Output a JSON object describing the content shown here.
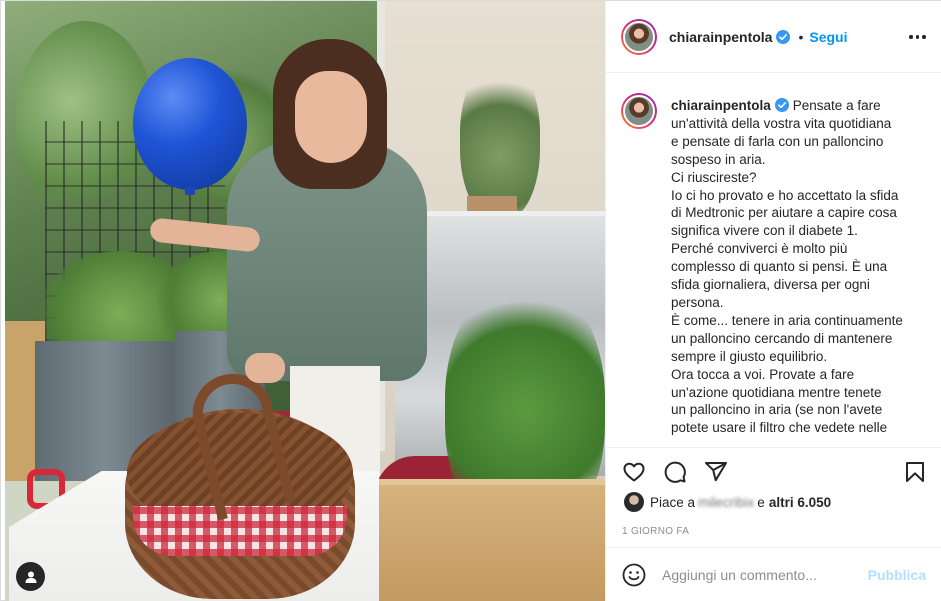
{
  "post": {
    "username": "chiarainpentola",
    "verified": true,
    "follow_label": "Segui",
    "separator": "•",
    "more_icon": "more-horizontal-icon"
  },
  "caption": {
    "username": "chiarainpentola",
    "lines": [
      "Pensate a fare",
      "un'attività della vostra vita quotidiana",
      "e pensate di farla con un palloncino",
      "sospeso in aria.",
      "Ci riuscireste?",
      "Io ci ho provato e ho accettato la sfida",
      "di Medtronic per aiutare a capire cosa",
      "significa vivere con il diabete 1.",
      "Perché conviverci è molto più",
      "complesso di quanto si pensi. È una",
      "sfida giornaliera, diversa per ogni",
      "persona.",
      "È come... tenere in aria continuamente",
      "un palloncino cercando di mantenere",
      "sempre il giusto equilibrio.",
      "Ora tocca a voi. Provate a fare",
      "un'azione quotidiana mentre tenete",
      "un palloncino in aria (se non l'avete",
      "potete usare il filtro che vedete nelle"
    ]
  },
  "actions": {
    "icons": [
      "heart-icon",
      "comment-icon",
      "share-icon",
      "bookmark-icon"
    ]
  },
  "likes": {
    "prefix": "Piace a",
    "blurred_user": "milecribix",
    "connector": "e",
    "count_text": "altri 6.050"
  },
  "time_ago": "1 GIORNO FA",
  "comment": {
    "placeholder": "Aggiungi un commento...",
    "publish_label": "Pubblica"
  },
  "colors": {
    "accent": "#0095f6",
    "publish_disabled": "#b2dffc",
    "text": "#262626",
    "muted": "#8e8e8e",
    "verified": "#3897f0"
  }
}
